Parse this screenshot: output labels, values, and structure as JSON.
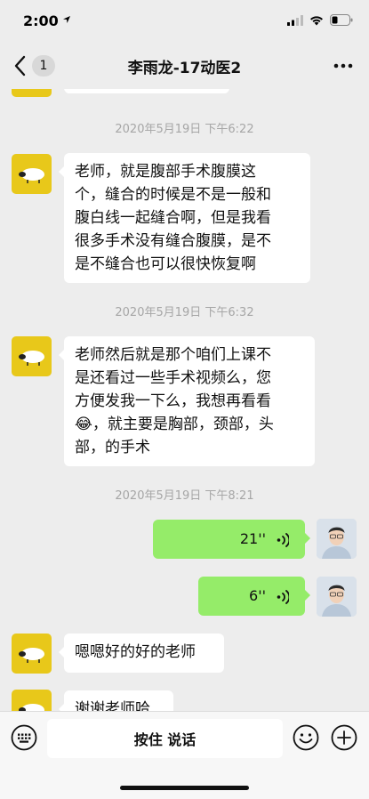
{
  "status_bar": {
    "time": "2:00"
  },
  "nav": {
    "unread_count": "1",
    "title": "李雨龙-17动医2"
  },
  "timestamps": {
    "t1": "2020年5月19日 下午6:22",
    "t2": "2020年5月19日 下午6:32",
    "t3": "2020年5月19日 下午8:21"
  },
  "messages": {
    "m1_lines": [
      "老师，就是腹部手术腹膜这",
      "个，缝合的时候是不是一般和",
      "腹白线一起缝合啊，但是我看",
      "很多手术没有缝合腹膜，是不",
      "是不缝合也可以很快恢复啊"
    ],
    "m2_lines": [
      "老师然后就是那个咱们上课不",
      "是还看过一些手术视频么，您",
      "方便发我一下么，我想再看看",
      "，就主要是胸部，颈部，头",
      "部，的手术"
    ],
    "m2_emoji": "😂",
    "voice1_duration": "21''",
    "voice2_duration": "6''",
    "m3": "嗯嗯好的好的老师",
    "m4": "谢谢老师哈"
  },
  "input": {
    "hold_to_talk": "按住 说话"
  },
  "colors": {
    "background": "#ededed",
    "bubble_out": "#95ec69",
    "bubble_in": "#ffffff",
    "avatar_sheep_bg": "#e8c81a"
  },
  "icons": [
    "location-arrow-icon",
    "signal-icon",
    "wifi-icon",
    "battery-icon",
    "back-chevron-icon",
    "more-dots-icon",
    "voice-wave-icon",
    "keyboard-icon",
    "emoji-icon",
    "plus-icon"
  ]
}
